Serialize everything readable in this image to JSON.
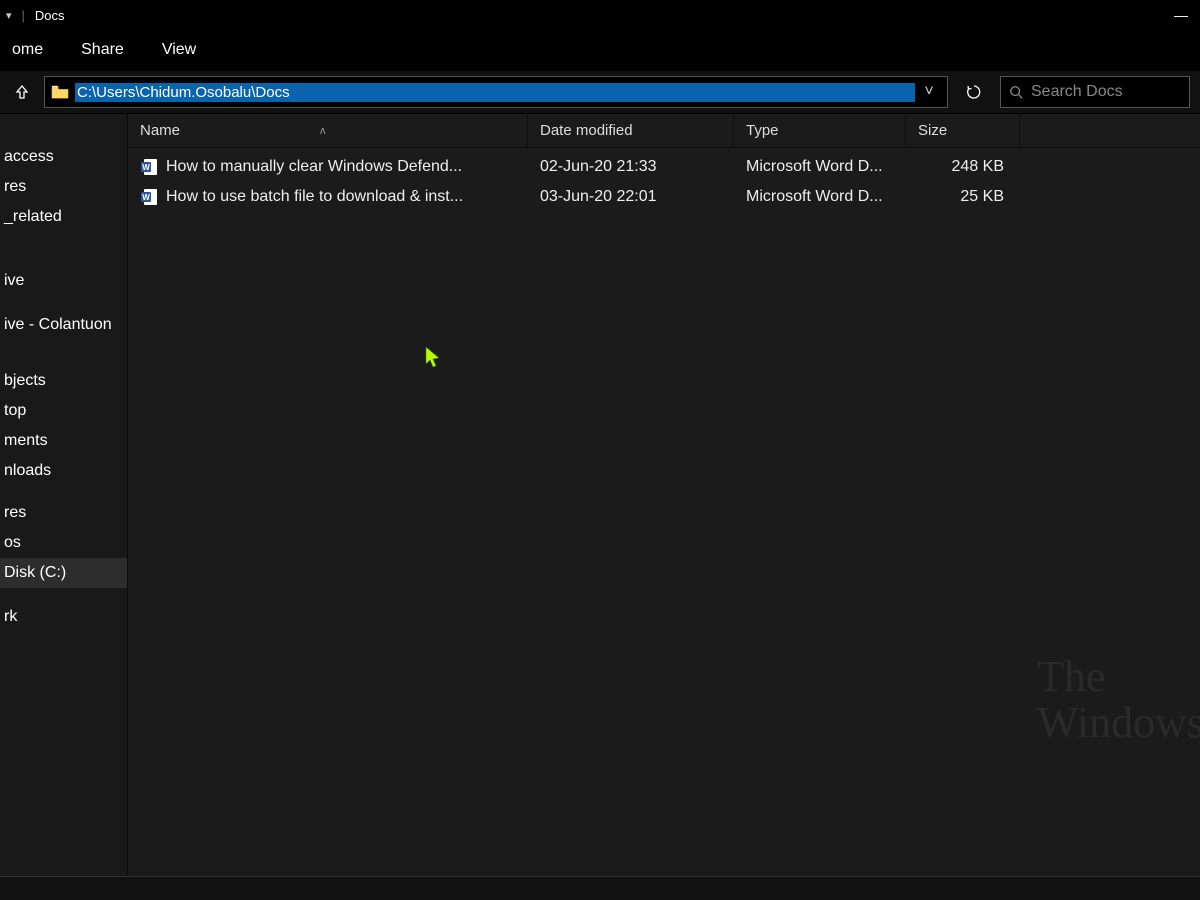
{
  "title": "Docs",
  "ribbon": {
    "tabs": [
      "ome",
      "Share",
      "View"
    ]
  },
  "address": {
    "path": "C:\\Users\\Chidum.Osobalu\\Docs",
    "search_placeholder": "Search Docs"
  },
  "sidebar": {
    "items": [
      {
        "label": "access"
      },
      {
        "label": "res"
      },
      {
        "label": "_related"
      }
    ],
    "items2": [
      {
        "label": "ive"
      },
      {
        "label": "ive - Colantuon"
      }
    ],
    "items3": [
      {
        "label": ""
      },
      {
        "label": "bjects"
      },
      {
        "label": "top"
      },
      {
        "label": "ments"
      },
      {
        "label": "nloads"
      },
      {
        "label": ""
      },
      {
        "label": "res"
      },
      {
        "label": "os"
      },
      {
        "label": " Disk (C:)",
        "selected": true
      }
    ],
    "items4": [
      {
        "label": "rk"
      }
    ]
  },
  "columns": {
    "name": "Name",
    "date": "Date modified",
    "type": "Type",
    "size": "Size"
  },
  "rows": [
    {
      "name": "How to manually clear Windows Defend...",
      "date": "02-Jun-20 21:33",
      "type": "Microsoft Word D...",
      "size": "248 KB"
    },
    {
      "name": "How to use batch file to download & inst...",
      "date": "03-Jun-20 22:01",
      "type": "Microsoft Word D...",
      "size": "25 KB"
    }
  ],
  "watermark": {
    "line1": "The",
    "line2": "Windows"
  }
}
